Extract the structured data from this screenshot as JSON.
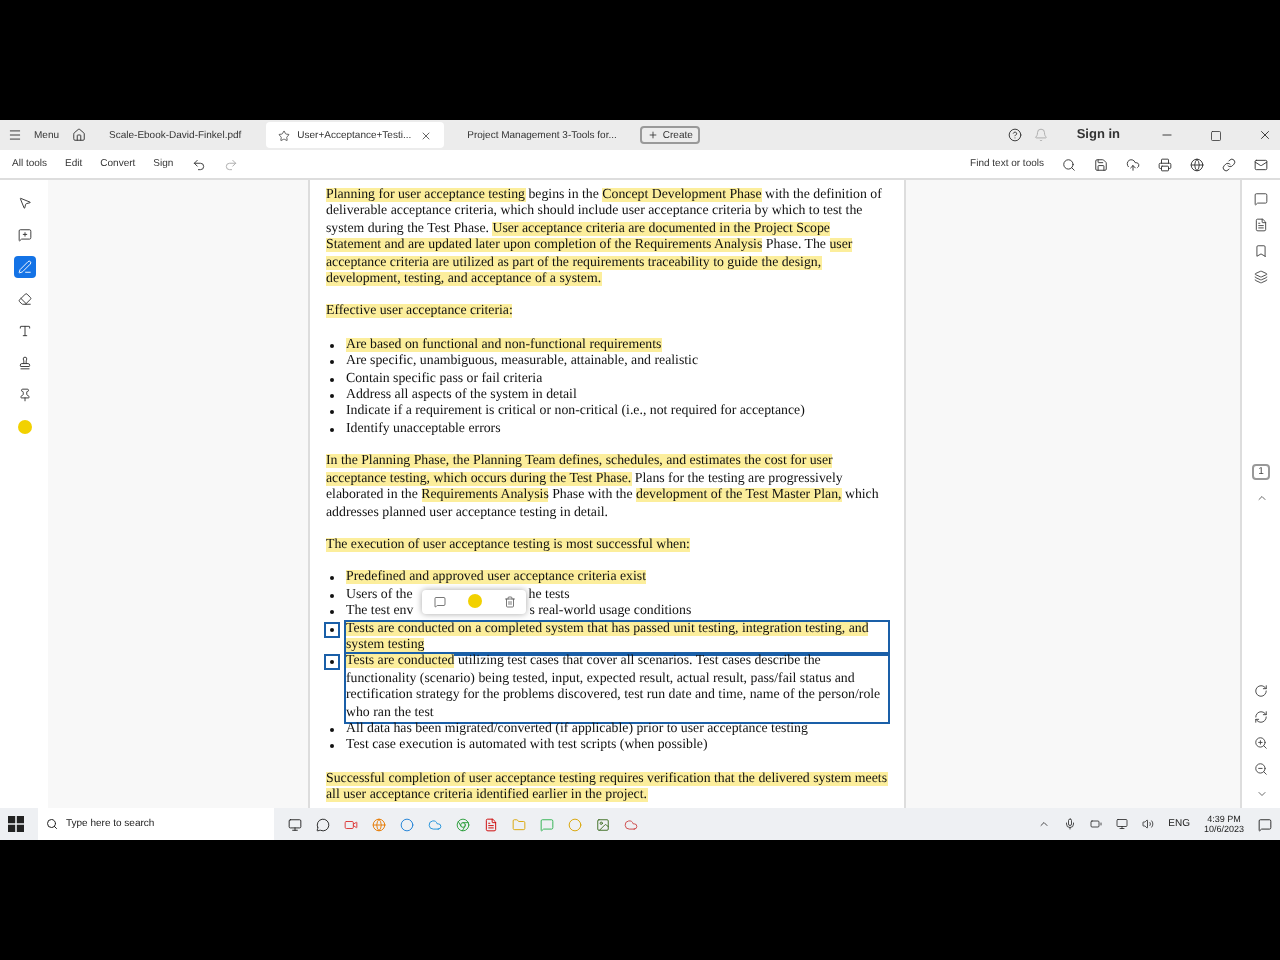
{
  "tab_bar": {
    "menu": "Menu",
    "tabs": [
      {
        "label": "Scale-Ebook-David-Finkel.pdf",
        "selected": false
      },
      {
        "label": "User+Acceptance+Testi...",
        "selected": true
      },
      {
        "label": "Project Management 3-Tools for...",
        "selected": false
      }
    ],
    "create": "Create",
    "sign_in": "Sign in"
  },
  "toolbar": {
    "items": [
      "All tools",
      "Edit",
      "Convert",
      "Sign"
    ],
    "search": "Find text or tools"
  },
  "left_tools": [
    {
      "kind": "cursor",
      "selected": false
    },
    {
      "kind": "comment",
      "selected": false
    },
    {
      "kind": "pen",
      "selected": true
    },
    {
      "kind": "eraser",
      "selected": false
    },
    {
      "kind": "text",
      "selected": false
    },
    {
      "kind": "stamp",
      "selected": false
    },
    {
      "kind": "pin",
      "selected": false
    },
    {
      "kind": "color",
      "selected": false
    }
  ],
  "document": {
    "blocks": [
      {
        "kind": "paragraph",
        "segments": [
          {
            "text": "Planning for user acceptance testing",
            "highlighted": true
          },
          {
            "text": " begins in the ",
            "highlighted": false
          },
          {
            "text": "Concept Development Phase",
            "highlighted": true
          },
          {
            "text": " with the definition of deliverable acceptance criteria, which should include user acceptance criteria by which to test the system during the Test Phase.  ",
            "highlighted": false
          },
          {
            "text": "User acceptance criteria are documented in the Project Scope Statement and are updated later upon completion of the Requirements Analysis",
            "highlighted": true
          },
          {
            "text": " Phase.  The ",
            "highlighted": false
          },
          {
            "text": "user acceptance criteria are utilized as part of the requirements traceability to guide the design, development, testing, and acceptance of a system.",
            "highlighted": true
          }
        ]
      },
      {
        "kind": "paragraph",
        "segments": [
          {
            "text": "Effective user acceptance criteria:",
            "highlighted": true
          }
        ]
      },
      {
        "kind": "list",
        "items": [
          {
            "segments": [
              {
                "text": "Are based on functional and non-functional requirements",
                "highlighted": true
              }
            ],
            "selected": false,
            "covered": false
          },
          {
            "segments": [
              {
                "text": "Are specific, unambiguous, measurable, attainable, and realistic",
                "highlighted": false
              }
            ],
            "selected": false,
            "covered": false
          },
          {
            "segments": [
              {
                "text": "Contain specific pass or fail criteria",
                "highlighted": false
              }
            ],
            "selected": false,
            "covered": false
          },
          {
            "segments": [
              {
                "text": "Address all aspects of the system in detail",
                "highlighted": false
              }
            ],
            "selected": false,
            "covered": false
          },
          {
            "segments": [
              {
                "text": "Indicate if a requirement is critical or non-critical (i.e., not required for acceptance)",
                "highlighted": false
              }
            ],
            "selected": false,
            "covered": false
          },
          {
            "segments": [
              {
                "text": "Identify unacceptable errors",
                "highlighted": false
              }
            ],
            "selected": false,
            "covered": false
          }
        ]
      },
      {
        "kind": "paragraph",
        "segments": [
          {
            "text": "In the Planning Phase, the Planning Team defines, schedules, and estimates the cost for user acceptance testing, which occurs during the Test Phase.",
            "highlighted": true
          },
          {
            "text": "  Plans for the testing are progressively elaborated in the ",
            "highlighted": false
          },
          {
            "text": "Requirements Analysis",
            "highlighted": true
          },
          {
            "text": " Phase with the ",
            "highlighted": false
          },
          {
            "text": "development of the Test Master Plan,",
            "highlighted": true
          },
          {
            "text": " which addresses planned user acceptance testing in detail.",
            "highlighted": false
          }
        ]
      },
      {
        "kind": "paragraph",
        "segments": [
          {
            "text": "The execution of user acceptance testing is most successful when:",
            "highlighted": true
          }
        ]
      },
      {
        "kind": "list",
        "items": [
          {
            "segments": [
              {
                "text": "Predefined and approved user acceptance criteria exist",
                "highlighted": true
              }
            ],
            "selected": false,
            "covered": false
          },
          {
            "segments": [
              {
                "text": "Users of the",
                "highlighted": false
              },
              {
                "text": "he tests",
                "highlighted": false
              }
            ],
            "selected": false,
            "covered": true
          },
          {
            "segments": [
              {
                "text": "The test env",
                "highlighted": false
              },
              {
                "text": "s real-world usage conditions",
                "highlighted": false
              }
            ],
            "selected": false,
            "covered": true
          },
          {
            "segments": [
              {
                "text": "Tests are conducted on a completed system that has passed unit testing, integration testing, and system testing",
                "highlighted": true
              }
            ],
            "selected": true,
            "covered": false
          },
          {
            "segments": [
              {
                "text": "Tests are conducted",
                "highlighted": true
              },
              {
                "text": " utilizing test cases that cover all scenarios.  Test cases describe the functionality (scenario) being tested, input, expected result, actual result, pass/fail status and rectification strategy for the problems discovered, test run date and time, name of the person/role who ran the test",
                "highlighted": false
              }
            ],
            "selected": true,
            "covered": false
          },
          {
            "segments": [
              {
                "text": "All data has been migrated/converted (if applicable) prior to user acceptance testing",
                "highlighted": false
              }
            ],
            "selected": false,
            "covered": false
          },
          {
            "segments": [
              {
                "text": "Test case execution is automated with test scripts (when possible)",
                "highlighted": false
              }
            ],
            "selected": false,
            "covered": false
          }
        ]
      },
      {
        "kind": "paragraph",
        "segments": [
          {
            "text": "Successful completion of user acceptance testing requires verification that the delivered system meets all user acceptance criteria identified earlier in the project.",
            "highlighted": true
          }
        ]
      }
    ]
  },
  "page_number": "1",
  "taskbar": {
    "search_placeholder": "Type here to search",
    "language": "ENG",
    "time": "4:39 PM",
    "date": "10/6/2023"
  }
}
